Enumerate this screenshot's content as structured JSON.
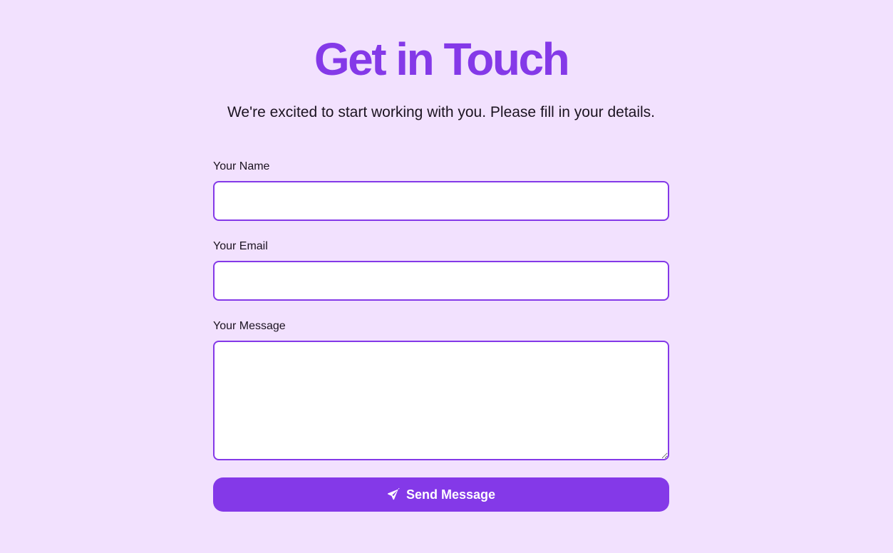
{
  "header": {
    "title": "Get in Touch",
    "subtitle": "We're excited to start working with you. Please fill in your details."
  },
  "form": {
    "name_label": "Your Name",
    "name_value": "",
    "email_label": "Your Email",
    "email_value": "",
    "message_label": "Your Message",
    "message_value": "",
    "submit_label": "Send Message",
    "submit_icon": "paper-plane-icon"
  },
  "colors": {
    "background": "#f2e1fe",
    "accent": "#8439e8",
    "text": "#1b1320",
    "field_background": "#ffffff"
  }
}
